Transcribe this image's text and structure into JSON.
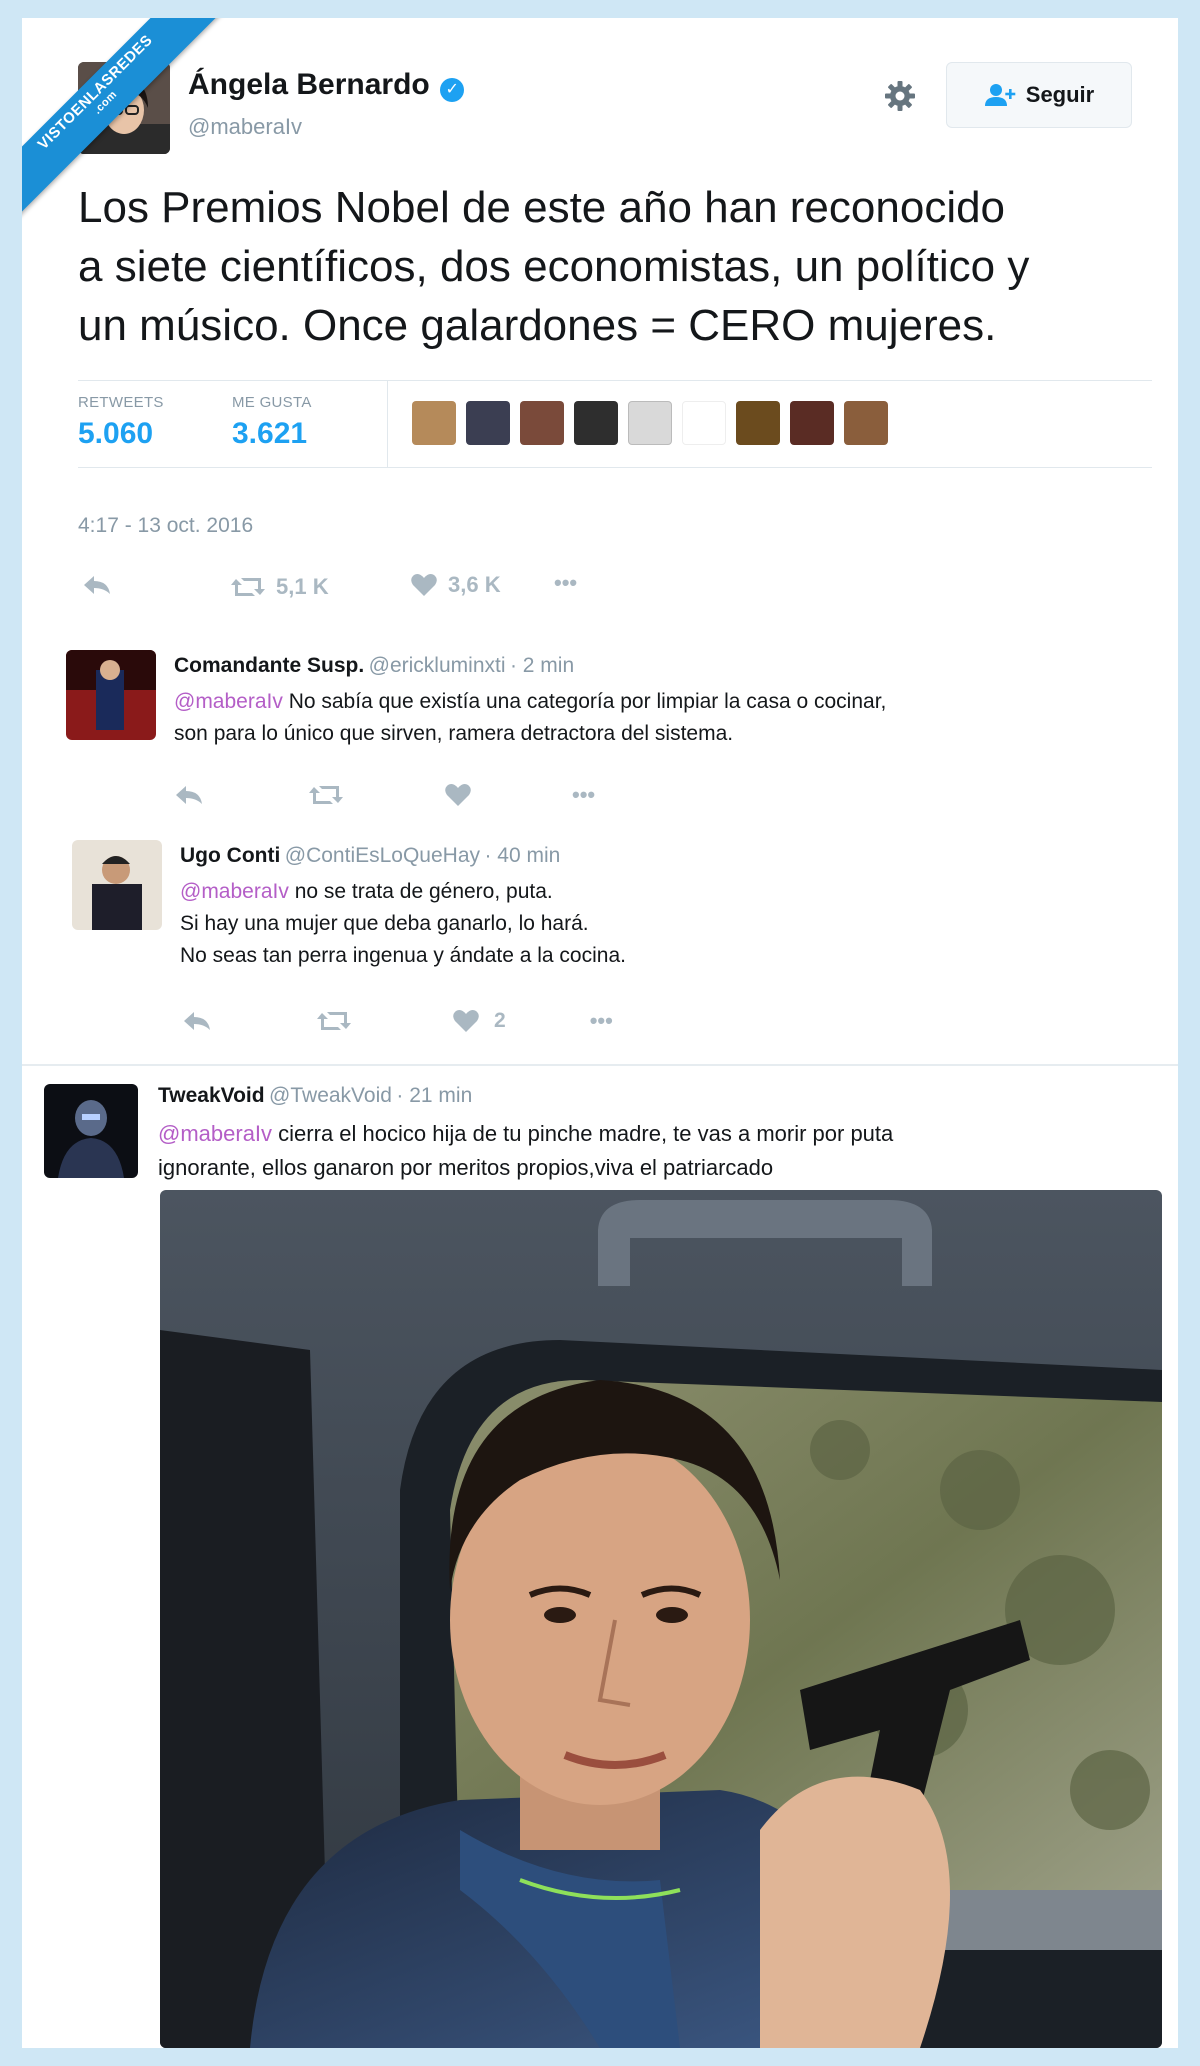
{
  "watermark": {
    "line1": "VISTOENLASREDES",
    "line2": ".com"
  },
  "tweet": {
    "author_name": "Ángela Bernardo",
    "author_handle": "@maberaIv",
    "follow_label": "Seguir",
    "lines": [
      "Los Premios Nobel de este año han reconocido",
      "a siete científicos, dos economistas, un político y",
      "un músico. Once galardones = CERO mujeres."
    ],
    "retweets_label": "RETWEETS",
    "retweets_value": "5.060",
    "likes_label": "ME GUSTA",
    "likes_value": "3.621",
    "timestamp": "4:17 - 13 oct. 2016",
    "retweet_count": "5,1 K",
    "like_count": "3,6 K",
    "more_label": "•••"
  },
  "replies": [
    {
      "name": "Comandante Susp.",
      "handle": "@erickluminxti",
      "time": "· 2 min",
      "mention": "@maberaIv",
      "line1": "No sabía que existía una categoría por limpiar la casa o cocinar,",
      "line2": "son para lo único que sirven, ramera detractora del sistema.",
      "like_count": ""
    },
    {
      "name": "Ugo Conti",
      "handle": "@ContiEsLoQueHay",
      "time": "· 40 min",
      "mention": "@maberaIv",
      "line1": "no se trata de género, puta.",
      "line2": "Si hay una mujer que deba ganarlo, lo hará.",
      "line3": "No seas tan perra ingenua y ándate a la cocina.",
      "like_count": "2"
    },
    {
      "name": "TweakVoid",
      "handle": "@TweakVoid",
      "time": "· 21 min",
      "mention": "@maberaIv",
      "line1": "cierra el hocico hija de tu pinche madre, te vas a morir por puta",
      "line2": "ignorante, ellos ganaron por meritos propios,viva el patriarcado"
    }
  ],
  "colors": {
    "page_bg": "#cfe7f5",
    "accent_blue": "#1da1f2",
    "mention_purple": "#b45ec7",
    "muted": "#8899a6"
  },
  "icons": [
    "gear-icon",
    "add-user-icon",
    "verified-icon",
    "reply-icon",
    "retweet-icon",
    "heart-icon",
    "more-icon"
  ]
}
